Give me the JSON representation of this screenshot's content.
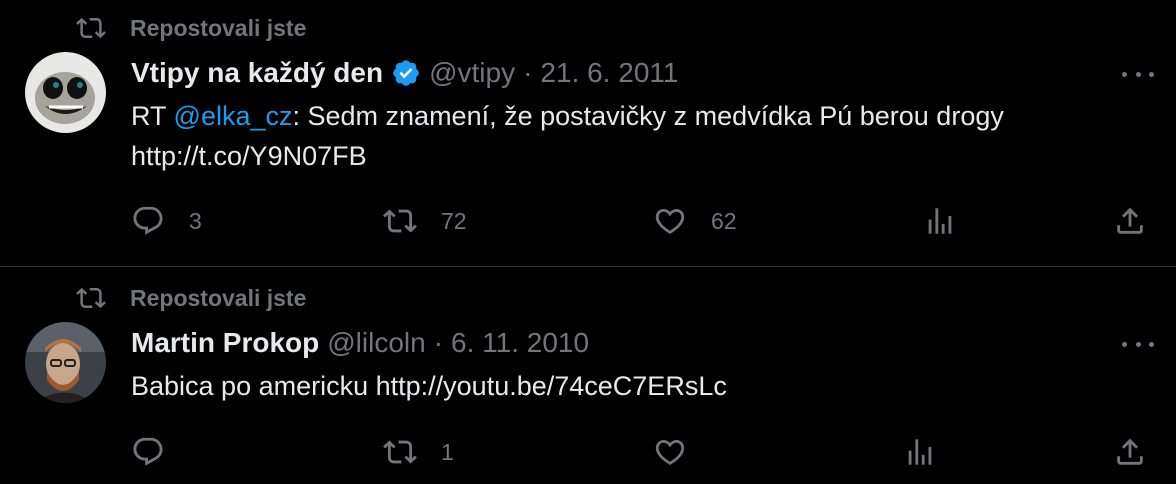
{
  "tweets": [
    {
      "repost_label": "Repostovali jste",
      "name": "Vtipy na každý den",
      "verified": true,
      "handle": "@vtipy",
      "separator": "·",
      "date": "21. 6. 2011",
      "text_prefix": "RT ",
      "mention": "@elka_cz",
      "text_suffix": ": Sedm znamení, že postavičky z medvídka Pú berou drogy",
      "text_line2": "http://t.co/Y9N07FB",
      "replies": "3",
      "reposts": "72",
      "likes": "62"
    },
    {
      "repost_label": "Repostovali jste",
      "name": "Martin Prokop",
      "handle": "@lilcoln",
      "separator": "·",
      "date": "6. 11. 2010",
      "text": "Babica po americku http://youtu.be/74ceC7ERsLc",
      "replies": "",
      "reposts": "1",
      "likes": ""
    }
  ],
  "colors": {
    "background": "#000000",
    "text": "#e7e9ea",
    "muted": "#71767b",
    "accent": "#1d9bf0",
    "divider": "#2f3336"
  },
  "icons": [
    "repost-icon",
    "verified-badge-icon",
    "more-icon",
    "reply-icon",
    "like-icon",
    "views-icon",
    "share-icon",
    "avatar"
  ]
}
